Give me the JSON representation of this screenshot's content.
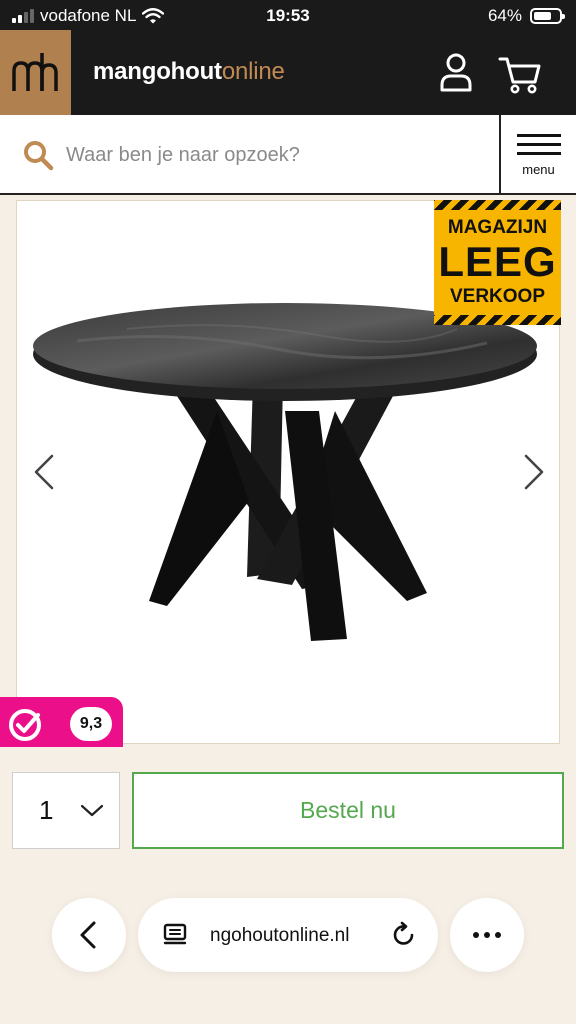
{
  "status_bar": {
    "carrier": "vodafone NL",
    "time": "19:53",
    "battery": "64%"
  },
  "header": {
    "brand_main": "mangohout",
    "brand_accent": "online"
  },
  "search": {
    "placeholder": "Waar ben je naar opzoek?"
  },
  "menu": {
    "label": "menu"
  },
  "badge": {
    "line1": "MAGAZIJN",
    "line2": "LEEG",
    "line3": "VERKOOP"
  },
  "review": {
    "score": "9,3"
  },
  "order": {
    "quantity": "1",
    "button_label": "Bestel nu"
  },
  "browser": {
    "url": "ngohoutonline.nl"
  },
  "colors": {
    "accent": "#c08a53",
    "header_bg": "#1a1a1a",
    "order_green": "#54a84d",
    "review_pink": "#ec0f8a",
    "badge_yellow": "#f7b500",
    "page_bg": "#f6efe6"
  }
}
